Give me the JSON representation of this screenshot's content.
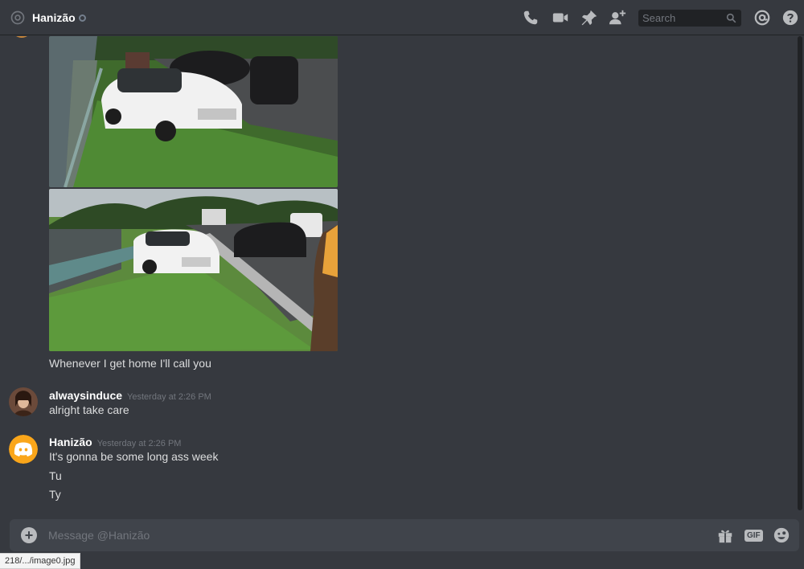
{
  "header": {
    "title": "Hanizão",
    "search_placeholder": "Search"
  },
  "messages": {
    "group1": {
      "text": "Whenever I get home I'll call you"
    },
    "group2": {
      "author": "alwaysinduce",
      "timestamp": "Yesterday at 2:26 PM",
      "lines": [
        "alright take care"
      ]
    },
    "group3": {
      "author": "Hanizão",
      "timestamp": "Yesterday at 2:26 PM",
      "lines": [
        "It's gonna be some long ass week",
        "Tu",
        "Ty"
      ]
    }
  },
  "composer": {
    "placeholder": "Message @Hanizão",
    "gif_label": "GIF"
  },
  "statusbar": {
    "url": "218/.../image0.jpg"
  },
  "colors": {
    "background": "#36393f",
    "header_border": "#202225",
    "text": "#dcddde",
    "muted": "#72767d",
    "discord_orange": "#faa61a"
  },
  "icons": [
    "at-icon",
    "status-dot-icon",
    "call-icon",
    "video-icon",
    "pin-icon",
    "add-friend-icon",
    "search-icon",
    "mentions-icon",
    "help-icon",
    "plus-icon",
    "gift-icon",
    "gif-icon",
    "emoji-icon"
  ]
}
